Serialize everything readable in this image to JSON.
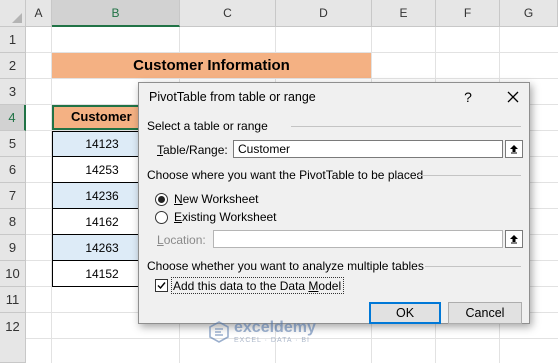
{
  "sheet": {
    "columns": [
      "A",
      "B",
      "C",
      "D",
      "E",
      "F",
      "G"
    ],
    "rows": [
      "1",
      "2",
      "3",
      "4",
      "5",
      "6",
      "7",
      "8",
      "9",
      "10",
      "11",
      "12"
    ],
    "banner": "Customer Information",
    "header_cell": "Customer",
    "values": [
      "14123",
      "14253",
      "14236",
      "14162",
      "14263",
      "14152"
    ]
  },
  "dialog": {
    "title": "PivotTable from table or range",
    "help": "?",
    "select_heading": "Select a table or range",
    "table_range_label_u": "T",
    "table_range_label_rest": "able/Range:",
    "table_range_value": "Customer",
    "place_heading": "Choose where you want the PivotTable to be placed",
    "new_ws_u": "N",
    "new_ws_rest": "ew Worksheet",
    "existing_ws_u": "E",
    "existing_ws_rest": "xisting Worksheet",
    "location_u": "L",
    "location_rest": "ocation:",
    "location_value": "",
    "multi_heading": "Choose whether you want to analyze multiple tables",
    "data_model_pre": "Add this data to the Data ",
    "data_model_u": "M",
    "data_model_post": "odel",
    "ok": "OK",
    "cancel": "Cancel"
  },
  "watermark": {
    "name": "exceldemy",
    "tagline": "EXCEL · DATA · BI"
  },
  "colors": {
    "accent_green": "#217346",
    "header_fill": "#f4b183",
    "stripe_fill": "#ddebf7",
    "focus_blue": "#0078d7"
  }
}
